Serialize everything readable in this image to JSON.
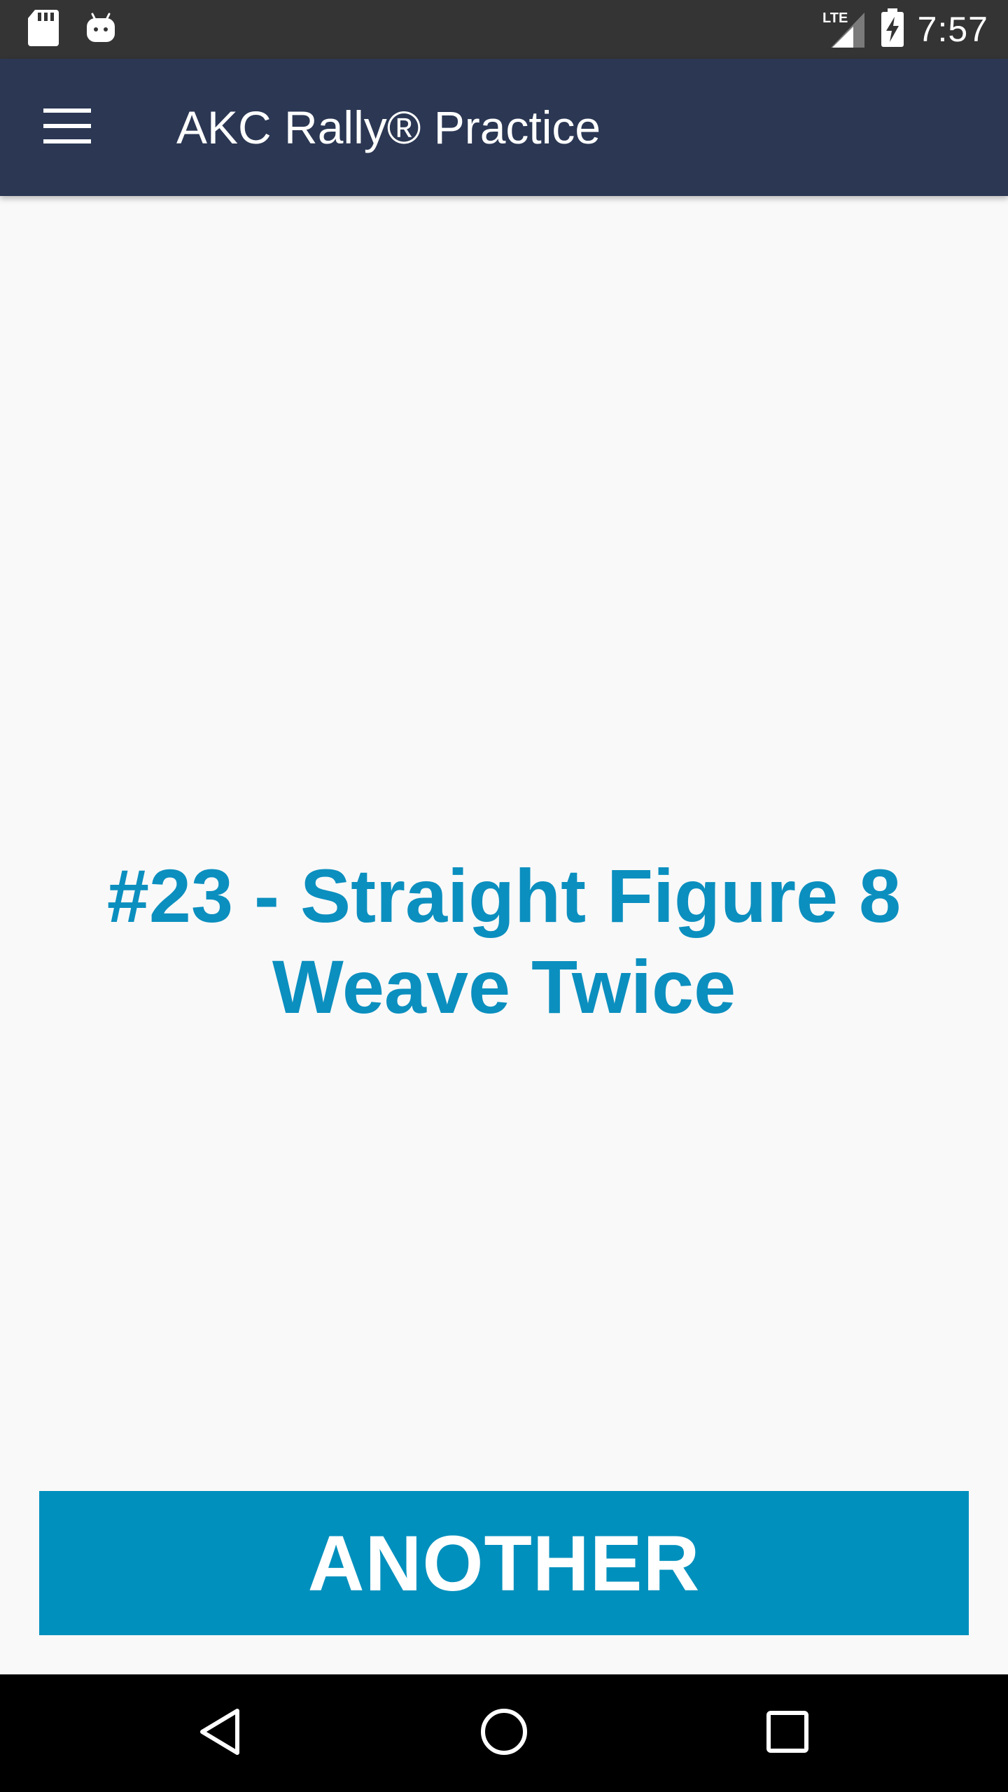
{
  "status_bar": {
    "time": "7:57",
    "network": "LTE",
    "icons": [
      "sd-card-icon",
      "android-icon",
      "lte-signal-icon",
      "battery-charging-icon"
    ]
  },
  "app_bar": {
    "title": "AKC Rally® Practice",
    "menu_icon": "hamburger-menu-icon"
  },
  "main": {
    "exercise": "#23 - Straight Figure 8 Weave Twice",
    "another_label": "ANOTHER"
  },
  "nav_bar": {
    "icons": [
      "back-icon",
      "home-icon",
      "recents-icon"
    ]
  },
  "colors": {
    "status_bar": "#343434",
    "app_bar": "#2b3753",
    "background": "#f9f9f9",
    "accent": "#0090bd",
    "exercise_text": "#0b8fbf",
    "nav_bar": "#000000"
  }
}
